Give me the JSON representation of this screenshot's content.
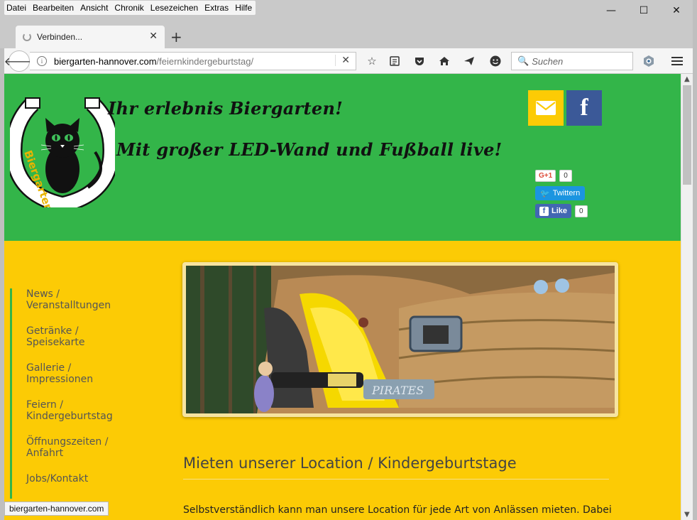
{
  "menu": [
    "Datei",
    "Bearbeiten",
    "Ansicht",
    "Chronik",
    "Lesezeichen",
    "Extras",
    "Hilfe"
  ],
  "window_controls": {
    "minimize": "—",
    "maximize": "☐",
    "close": "✕"
  },
  "tab": {
    "title": "Verbinden...",
    "close": "✕",
    "new_tab": "+"
  },
  "nav": {
    "url_host": "biergarten-hannover.com",
    "url_path": "/feiernkindergeburtstag/",
    "search_placeholder": "Suchen"
  },
  "site": {
    "tagline_1": "Ihr erlebnis Biergarten!",
    "tagline_2": "Mit großer LED-Wand und Fußball live!",
    "logo_text": "Biergarten Waldkater",
    "share": {
      "gplus_label": "G+1",
      "gplus_count": "0",
      "twitter_label": "Twittern",
      "fb_label": "Like",
      "fb_count": "0"
    },
    "sidenav": [
      {
        "l1": "News /",
        "l2": "Veranstalltungen"
      },
      {
        "l1": "Getränke /",
        "l2": "Speisekarte"
      },
      {
        "l1": "Gallerie /",
        "l2": "Impressionen"
      },
      {
        "l1": "Feiern /",
        "l2": "Kindergeburtstag"
      },
      {
        "l1": "Öffnungszeiten /",
        "l2": "Anfahrt"
      },
      {
        "l1": "Jobs/Kontakt",
        "l2": ""
      }
    ],
    "hero_sign": "PIRATES",
    "heading": "Mieten unserer Location / Kindergeburtstage",
    "paragraph": "Selbstverständlich kann man unsere Location für jede Art von Anlässen mieten. Dabei"
  },
  "status": "biergarten-hannover.com",
  "colors": {
    "header_green": "#33b549",
    "body_yellow": "#fccb05",
    "facebook": "#3b5998",
    "twitter": "#1b95e0"
  }
}
